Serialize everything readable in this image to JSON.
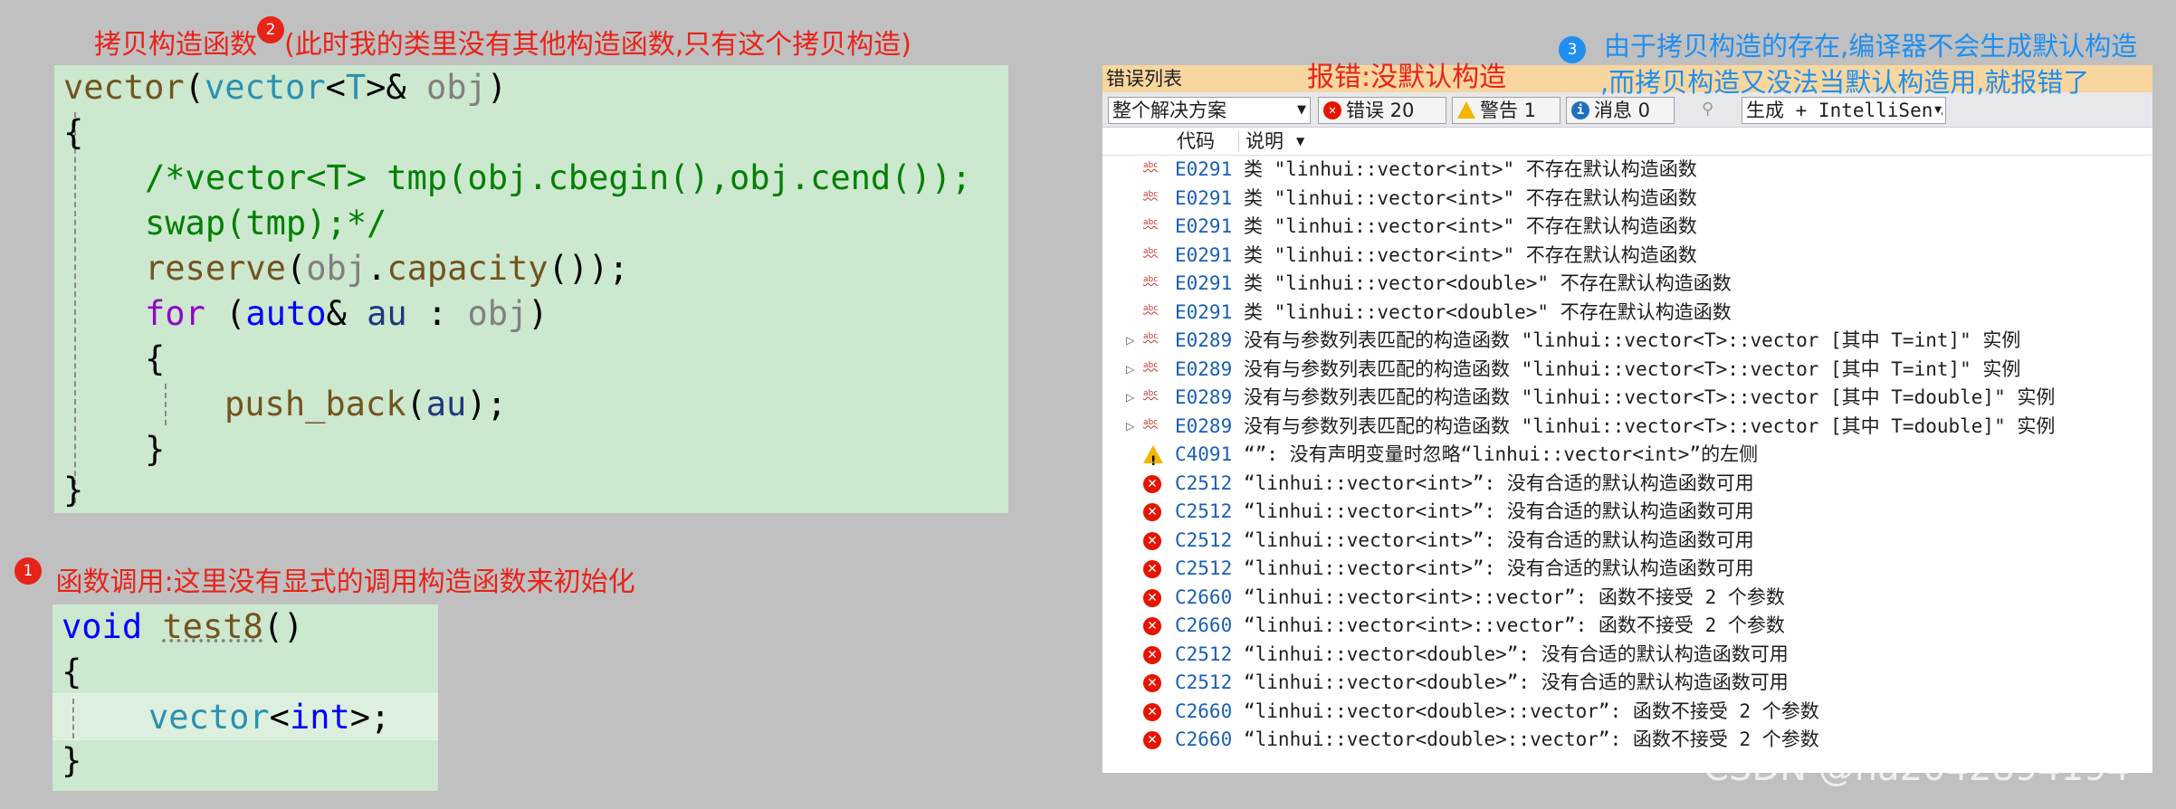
{
  "annotations": {
    "note2_text": "拷贝构造函数",
    "note2_badge": "2",
    "note2_detail": "(此时我的类里没有其他构造函数,只有这个拷贝构造)",
    "note1_badge": "1",
    "note1_text": "函数调用:这里没有显式的调用构造函数来初始化",
    "error_title_note": "报错:没默认构造",
    "note3_badge": "3",
    "note3_line1": "由于拷贝构造的存在,编译器不会生成默认构造",
    "note3_line2": ",而拷贝构造又没法当默认构造用,就报错了"
  },
  "code_copy_ctor": {
    "l1_fn": "vector",
    "l1_p1": "(",
    "l1_ty": "vector",
    "l1_lt": "<",
    "l1_T": "T",
    "l1_gt": ">& ",
    "l1_obj": "obj",
    "l1_p2": ")",
    "l2": "{",
    "l3": "/*vector<T> tmp(obj.cbegin(),obj.cend());",
    "l4": "swap(tmp);*/",
    "l5_fn": "reserve",
    "l5_a": "(",
    "l5_obj": "obj",
    "l5_dot": ".",
    "l5_cap": "capacity",
    "l5_b": "());",
    "l6_for": "for",
    "l6_a": " (",
    "l6_auto": "auto",
    "l6_amp": "& ",
    "l6_au": "au",
    "l6_colon": " : ",
    "l6_obj": "obj",
    "l6_b": ")",
    "l7": "{",
    "l8_fn": "push_back",
    "l8_a": "(",
    "l8_au": "au",
    "l8_b": ");",
    "l9": "}",
    "l10": "}"
  },
  "code_test8": {
    "l1_void": "void",
    "l1_sp": " ",
    "l1_fn": "test8",
    "l1_p": "()",
    "l2": "{",
    "l3_ty": "vector",
    "l3_lt": "<",
    "l3_int": "int",
    "l3_gt": ">;",
    "l4": "}"
  },
  "error_list": {
    "title": "错误列表",
    "scope": "整个解决方案",
    "errors_label": "错误 20",
    "warnings_label": "警告 1",
    "messages_label": "消息 0",
    "build_filter": "生成 + IntelliSense",
    "col_code": "代码",
    "col_desc": "说明",
    "rows": [
      {
        "icon": "intellisense-error-icon",
        "expand": "",
        "code": "E0291",
        "desc": "类 \"linhui::vector<int>\" 不存在默认构造函数"
      },
      {
        "icon": "intellisense-error-icon",
        "expand": "",
        "code": "E0291",
        "desc": "类 \"linhui::vector<int>\" 不存在默认构造函数"
      },
      {
        "icon": "intellisense-error-icon",
        "expand": "",
        "code": "E0291",
        "desc": "类 \"linhui::vector<int>\" 不存在默认构造函数"
      },
      {
        "icon": "intellisense-error-icon",
        "expand": "",
        "code": "E0291",
        "desc": "类 \"linhui::vector<int>\" 不存在默认构造函数"
      },
      {
        "icon": "intellisense-error-icon",
        "expand": "",
        "code": "E0291",
        "desc": "类 \"linhui::vector<double>\" 不存在默认构造函数"
      },
      {
        "icon": "intellisense-error-icon",
        "expand": "",
        "code": "E0291",
        "desc": "类 \"linhui::vector<double>\" 不存在默认构造函数"
      },
      {
        "icon": "intellisense-error-icon",
        "expand": "▷",
        "code": "E0289",
        "desc": "没有与参数列表匹配的构造函数 \"linhui::vector<T>::vector [其中 T=int]\" 实例"
      },
      {
        "icon": "intellisense-error-icon",
        "expand": "▷",
        "code": "E0289",
        "desc": "没有与参数列表匹配的构造函数 \"linhui::vector<T>::vector [其中 T=int]\" 实例"
      },
      {
        "icon": "intellisense-error-icon",
        "expand": "▷",
        "code": "E0289",
        "desc": "没有与参数列表匹配的构造函数 \"linhui::vector<T>::vector [其中 T=double]\" 实例"
      },
      {
        "icon": "intellisense-error-icon",
        "expand": "▷",
        "code": "E0289",
        "desc": "没有与参数列表匹配的构造函数 \"linhui::vector<T>::vector [其中 T=double]\" 实例"
      },
      {
        "icon": "warning-icon",
        "expand": "",
        "code": "C4091",
        "desc": "“”: 没有声明变量时忽略“linhui::vector<int>”的左侧"
      },
      {
        "icon": "error-icon",
        "expand": "",
        "code": "C2512",
        "desc": "“linhui::vector<int>”: 没有合适的默认构造函数可用"
      },
      {
        "icon": "error-icon",
        "expand": "",
        "code": "C2512",
        "desc": "“linhui::vector<int>”: 没有合适的默认构造函数可用"
      },
      {
        "icon": "error-icon",
        "expand": "",
        "code": "C2512",
        "desc": "“linhui::vector<int>”: 没有合适的默认构造函数可用"
      },
      {
        "icon": "error-icon",
        "expand": "",
        "code": "C2512",
        "desc": "“linhui::vector<int>”: 没有合适的默认构造函数可用"
      },
      {
        "icon": "error-icon",
        "expand": "",
        "code": "C2660",
        "desc": "“linhui::vector<int>::vector”: 函数不接受 2 个参数"
      },
      {
        "icon": "error-icon",
        "expand": "",
        "code": "C2660",
        "desc": "“linhui::vector<int>::vector”: 函数不接受 2 个参数"
      },
      {
        "icon": "error-icon",
        "expand": "",
        "code": "C2512",
        "desc": "“linhui::vector<double>”: 没有合适的默认构造函数可用"
      },
      {
        "icon": "error-icon",
        "expand": "",
        "code": "C2512",
        "desc": "“linhui::vector<double>”: 没有合适的默认构造函数可用"
      },
      {
        "icon": "error-icon",
        "expand": "",
        "code": "C2660",
        "desc": "“linhui::vector<double>::vector”: 函数不接受 2 个参数"
      },
      {
        "icon": "error-icon",
        "expand": "",
        "code": "C2660",
        "desc": "“linhui::vector<double>::vector”: 函数不接受 2 个参数"
      }
    ]
  },
  "watermark": "CSDN @ha2042894194"
}
